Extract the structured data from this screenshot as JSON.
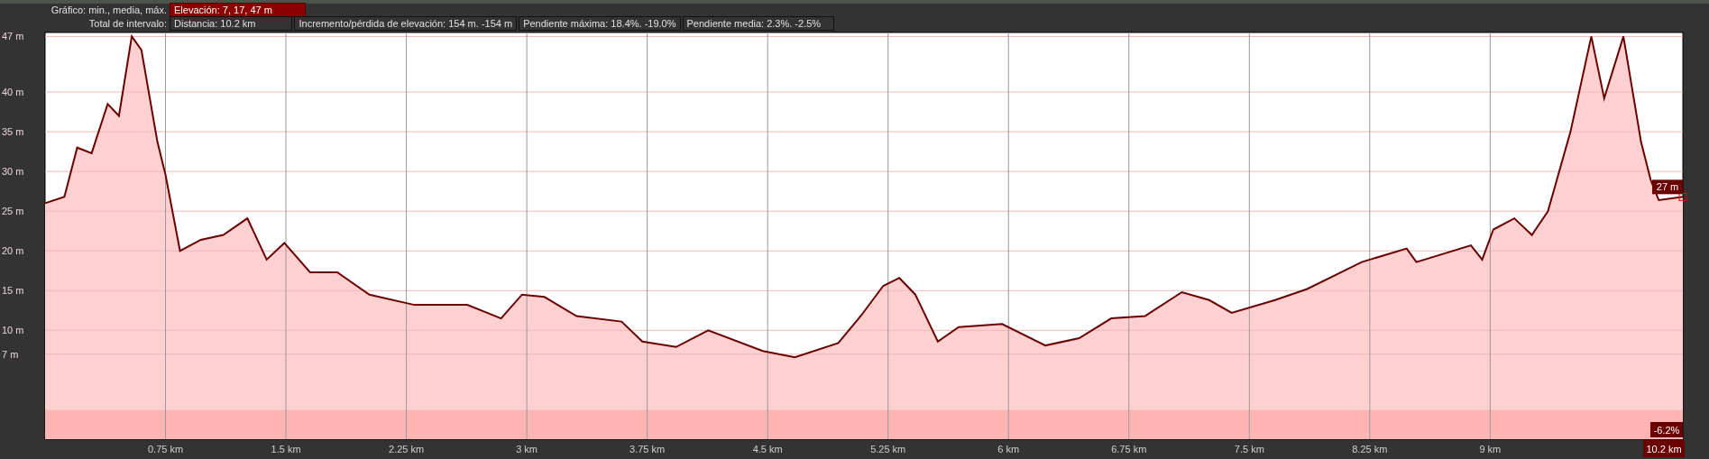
{
  "header": [
    {
      "label": "Gráfico: min., media, máx.",
      "fields": [
        {
          "text": "Elevación: 7, 17, 47 m",
          "highlighted": true
        }
      ]
    },
    {
      "label": "Total de intervalo:",
      "fields": [
        {
          "text": "Distancia: 10.2 km",
          "highlighted": false
        },
        {
          "text": "Incremento/pérdida de elevación: 154 m. -154 m",
          "highlighted": false
        },
        {
          "text": "Pendiente máxima: 18.4%. -19.0%",
          "highlighted": false
        },
        {
          "text": "Pendiente media: 2.3%. -2.5%",
          "highlighted": false
        }
      ]
    }
  ],
  "chart": {
    "end_elevation": "27 m",
    "end_slope": "-6.2%",
    "end_distance": "10.2 km",
    "chart_data": {
      "type": "area",
      "grid": true,
      "xlim": [
        0,
        10.2
      ],
      "ylim": [
        -3.7,
        47.5
      ],
      "xticks": [
        {
          "value": 0.75,
          "label": "0.75 km"
        },
        {
          "value": 1.5,
          "label": "1.5 km"
        },
        {
          "value": 2.25,
          "label": "2.25 km"
        },
        {
          "value": 3,
          "label": "3 km"
        },
        {
          "value": 3.75,
          "label": "3.75 km"
        },
        {
          "value": 4.5,
          "label": "4.5 km"
        },
        {
          "value": 5.25,
          "label": "5.25 km"
        },
        {
          "value": 6,
          "label": "6 km"
        },
        {
          "value": 6.75,
          "label": "6.75 km"
        },
        {
          "value": 7.5,
          "label": "7.5 km"
        },
        {
          "value": 8.25,
          "label": "8.25 km"
        },
        {
          "value": 9,
          "label": "9 km"
        }
      ],
      "yticks": [
        {
          "value": 47,
          "label": "47 m"
        },
        {
          "value": 40,
          "label": "40 m"
        },
        {
          "value": 35,
          "label": "35 m"
        },
        {
          "value": 30,
          "label": "30 m"
        },
        {
          "value": 25,
          "label": "25 m"
        },
        {
          "value": 20,
          "label": "20 m"
        },
        {
          "value": 15,
          "label": "15 m"
        },
        {
          "value": 10,
          "label": "10 m"
        },
        {
          "value": 7,
          "label": "7 m"
        }
      ],
      "x": [
        0,
        0.12,
        0.2,
        0.29,
        0.39,
        0.46,
        0.54,
        0.6,
        0.7,
        0.75,
        0.84,
        0.97,
        1.11,
        1.26,
        1.38,
        1.49,
        1.65,
        1.82,
        2.02,
        2.3,
        2.63,
        2.84,
        2.97,
        3.11,
        3.31,
        3.59,
        3.72,
        3.93,
        4.13,
        4.47,
        4.67,
        4.94,
        5.08,
        5.22,
        5.32,
        5.42,
        5.56,
        5.69,
        5.96,
        6.23,
        6.44,
        6.64,
        6.85,
        7.08,
        7.25,
        7.39,
        7.66,
        7.86,
        8.2,
        8.48,
        8.54,
        8.88,
        8.95,
        9.02,
        9.15,
        9.26,
        9.36,
        9.5,
        9.63,
        9.71,
        9.83,
        9.94,
        10.0,
        10.05,
        10.2
      ],
      "series": [
        {
          "color": "#6b0000",
          "values": [
            26,
            26.8,
            33,
            32.3,
            38.5,
            37,
            47,
            45.3,
            33.7,
            29.6,
            20,
            21.4,
            22,
            24.1,
            18.9,
            21,
            17.3,
            17.3,
            14.5,
            13.2,
            13.2,
            11.5,
            14.5,
            14.2,
            11.8,
            11.1,
            8.6,
            7.9,
            10,
            7.4,
            6.6,
            8.4,
            11.8,
            15.6,
            16.6,
            14.5,
            8.6,
            10.4,
            10.8,
            8.1,
            9,
            11.5,
            11.8,
            14.8,
            13.8,
            12.2,
            13.8,
            15.2,
            18.6,
            20.3,
            18.6,
            20.7,
            18.9,
            22.7,
            24.1,
            22,
            25,
            35,
            47,
            39.2,
            47,
            33.7,
            28.9,
            26.4,
            26.8
          ]
        }
      ]
    }
  }
}
